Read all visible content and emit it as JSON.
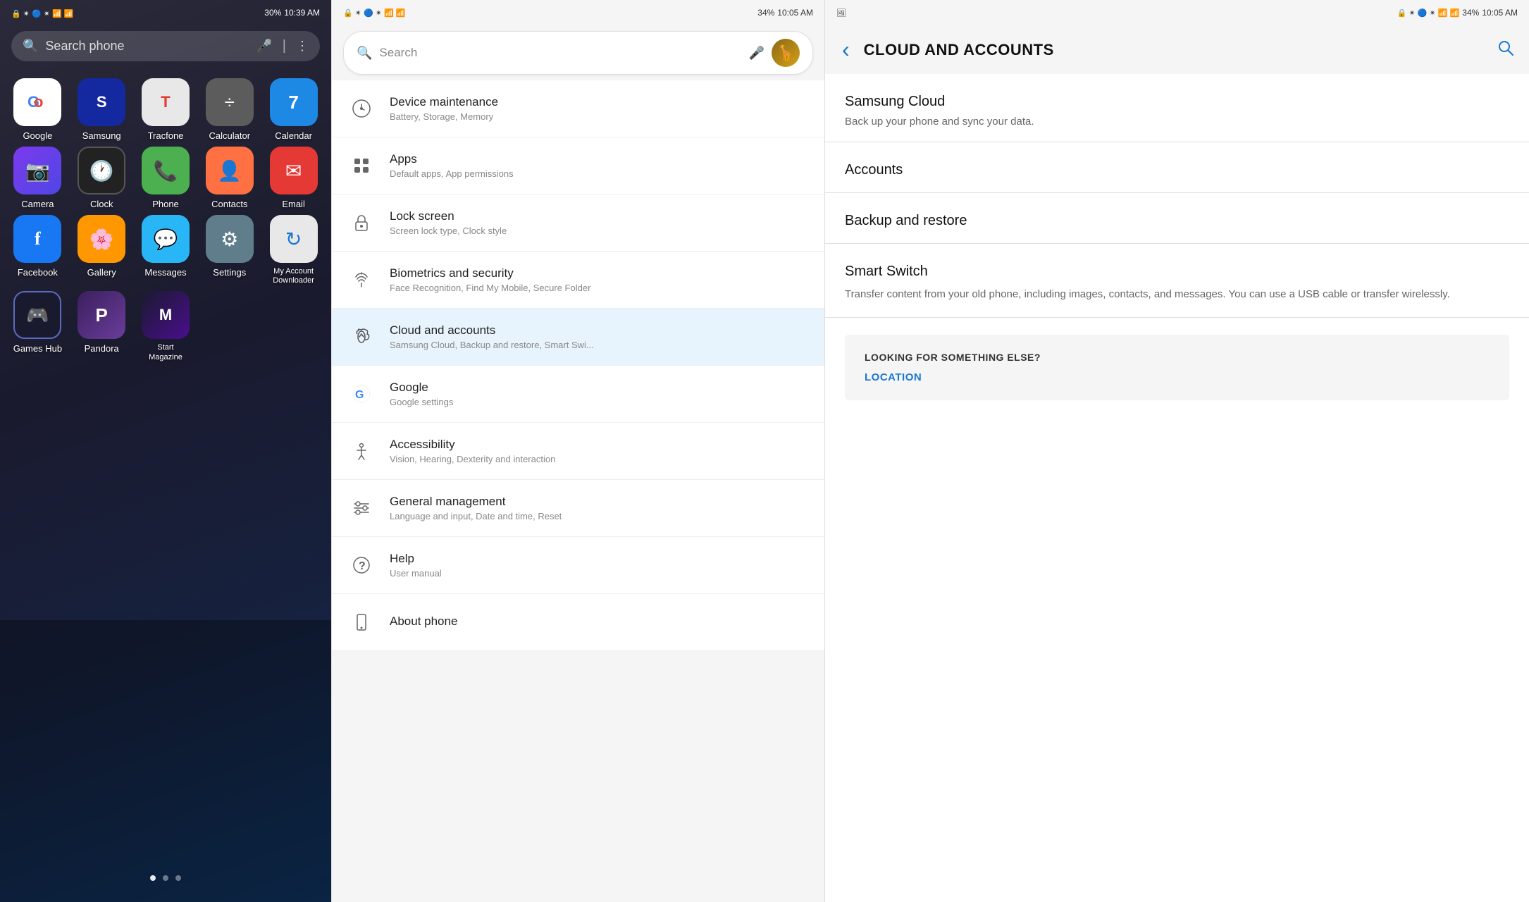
{
  "panel1": {
    "statusBar": {
      "time": "10:39 AM",
      "battery": "30%",
      "icons": "🔒 📶 🔵 ✴ 📶 📶"
    },
    "search": {
      "placeholder": "Search phone",
      "micIcon": "🎤",
      "menuIcon": "⋮"
    },
    "apps": [
      {
        "id": "google",
        "label": "Google",
        "icon": "G",
        "iconClass": "icon-google",
        "iconColor": "#4285F4"
      },
      {
        "id": "samsung",
        "label": "Samsung",
        "icon": "S",
        "iconClass": "icon-samsung"
      },
      {
        "id": "tracfone",
        "label": "Tracfone",
        "icon": "T",
        "iconClass": "icon-tracfone",
        "iconColor": "#e53935"
      },
      {
        "id": "calculator",
        "label": "Calculator",
        "icon": "÷",
        "iconClass": "icon-calculator"
      },
      {
        "id": "calendar",
        "label": "Calendar",
        "icon": "7",
        "iconClass": "icon-calendar"
      },
      {
        "id": "camera",
        "label": "Camera",
        "icon": "📷",
        "iconClass": "icon-camera"
      },
      {
        "id": "clock",
        "label": "Clock",
        "icon": "🕐",
        "iconClass": "icon-clock"
      },
      {
        "id": "phone",
        "label": "Phone",
        "icon": "📞",
        "iconClass": "icon-phone"
      },
      {
        "id": "contacts",
        "label": "Contacts",
        "icon": "👤",
        "iconClass": "icon-contacts"
      },
      {
        "id": "email",
        "label": "Email",
        "icon": "✉",
        "iconClass": "icon-email"
      },
      {
        "id": "facebook",
        "label": "Facebook",
        "icon": "f",
        "iconClass": "icon-facebook"
      },
      {
        "id": "gallery",
        "label": "Gallery",
        "icon": "🌸",
        "iconClass": "icon-gallery"
      },
      {
        "id": "messages",
        "label": "Messages",
        "icon": "💬",
        "iconClass": "icon-messages"
      },
      {
        "id": "settings",
        "label": "Settings",
        "icon": "⚙",
        "iconClass": "icon-settings"
      },
      {
        "id": "myaccount",
        "label": "My Account Downloader",
        "icon": "↻",
        "iconClass": "icon-myaccount",
        "iconColor": "#1976D2"
      },
      {
        "id": "gameshub",
        "label": "Games Hub",
        "icon": "🎮",
        "iconClass": "icon-gameshub"
      },
      {
        "id": "pandora",
        "label": "Pandora",
        "icon": "P",
        "iconClass": "icon-pandora"
      },
      {
        "id": "startmag",
        "label": "Start Magazine",
        "icon": "M",
        "iconClass": "icon-startmag"
      }
    ],
    "pageDots": [
      {
        "active": true
      },
      {
        "active": false
      },
      {
        "active": false
      }
    ]
  },
  "panel2": {
    "statusBar": {
      "time": "10:05 AM",
      "battery": "34%"
    },
    "search": {
      "placeholder": "Search",
      "micIcon": "🎤"
    },
    "menuItems": [
      {
        "id": "device-maintenance",
        "icon": "🔄",
        "title": "Device maintenance",
        "subtitle": "Battery, Storage, Memory"
      },
      {
        "id": "apps",
        "icon": "⬛",
        "title": "Apps",
        "subtitle": "Default apps, App permissions"
      },
      {
        "id": "lock-screen",
        "icon": "🔒",
        "title": "Lock screen",
        "subtitle": "Screen lock type, Clock style"
      },
      {
        "id": "biometrics",
        "icon": "🛡",
        "title": "Biometrics and security",
        "subtitle": "Face Recognition, Find My Mobile, Secure Folder"
      },
      {
        "id": "cloud-accounts",
        "icon": "🔑",
        "title": "Cloud and accounts",
        "subtitle": "Samsung Cloud, Backup and restore, Smart Swi..."
      },
      {
        "id": "google",
        "icon": "G",
        "title": "Google",
        "subtitle": "Google settings"
      },
      {
        "id": "accessibility",
        "icon": "♿",
        "title": "Accessibility",
        "subtitle": "Vision, Hearing, Dexterity and interaction"
      },
      {
        "id": "general-management",
        "icon": "⚙",
        "title": "General management",
        "subtitle": "Language and input, Date and time, Reset"
      },
      {
        "id": "help",
        "icon": "?",
        "title": "Help",
        "subtitle": "User manual"
      },
      {
        "id": "about-phone",
        "icon": "ℹ",
        "title": "About phone",
        "subtitle": ""
      }
    ]
  },
  "panel3": {
    "statusBar": {
      "time": "10:05 AM",
      "battery": "34%"
    },
    "header": {
      "backIcon": "‹",
      "title": "CLOUD AND ACCOUNTS",
      "searchIcon": "🔍"
    },
    "sections": [
      {
        "id": "samsung-cloud",
        "title": "Samsung Cloud",
        "subtitle": "Back up your phone and sync your data."
      },
      {
        "id": "accounts",
        "title": "Accounts",
        "subtitle": ""
      },
      {
        "id": "backup-restore",
        "title": "Backup and restore",
        "subtitle": ""
      },
      {
        "id": "smart-switch",
        "title": "Smart Switch",
        "subtitle": "Transfer content from your old phone, including images, contacts, and messages. You can use a USB cable or transfer wirelessly."
      }
    ],
    "lookingBox": {
      "title": "LOOKING FOR SOMETHING ELSE?",
      "link": "LOCATION"
    }
  }
}
